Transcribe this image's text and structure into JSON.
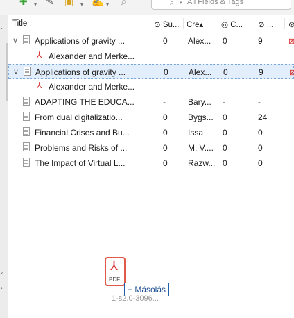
{
  "toolbar": {
    "add_icon": "✚",
    "caret": "▾",
    "wand_icon": "✎",
    "collection_icon": "▣",
    "note_icon": "✍",
    "link_icon": "⌕",
    "search_icon": "⌕",
    "search_placeholder": "All Fields & Tags"
  },
  "columns": {
    "title": "Title",
    "summary": "⊙ Su...",
    "creator": "Cre▴",
    "cites": "◎ C...",
    "ref": "⊘ ...",
    "attach": "⊘"
  },
  "rows": [
    {
      "twisty": "∨",
      "title": "Applications of gravity ...",
      "summary": "0",
      "creator": "Alex...",
      "cites": "0",
      "ref": "9",
      "attach": "⊠"
    },
    {
      "title": "Alexander and Merke..."
    },
    {
      "twisty": "∨",
      "title": "Applications of gravity ...",
      "summary": "0",
      "creator": "Alex...",
      "cites": "0",
      "ref": "9",
      "attach": "⊠"
    },
    {
      "title": "Alexander and Merke..."
    },
    {
      "title": "ADAPTING THE EDUCA...",
      "summary": "-",
      "creator": "Bary...",
      "cites": "-",
      "ref": "-"
    },
    {
      "title": "From dual digitalizatio...",
      "summary": "0",
      "creator": "Bygs...",
      "cites": "0",
      "ref": "24"
    },
    {
      "title": "Financial Crises and Bu...",
      "summary": "0",
      "creator": "Issa",
      "cites": "0",
      "ref": "0"
    },
    {
      "title": "Problems and Risks of ...",
      "summary": "0",
      "creator": "M. V....",
      "cites": "0",
      "ref": "0"
    },
    {
      "title": "The Impact of Virtual L...",
      "summary": "0",
      "creator": "Razw...",
      "cites": "0",
      "ref": "0"
    }
  ],
  "pdf_glyph": "⅄",
  "drag": {
    "file_label": "PDF",
    "copy_label": "+ Másolás",
    "file_name": "1-s2.0-3096..."
  },
  "colors": {
    "accent": "#1f5ea8",
    "selection": "#e2eefb",
    "pdf": "#d62f2f"
  }
}
